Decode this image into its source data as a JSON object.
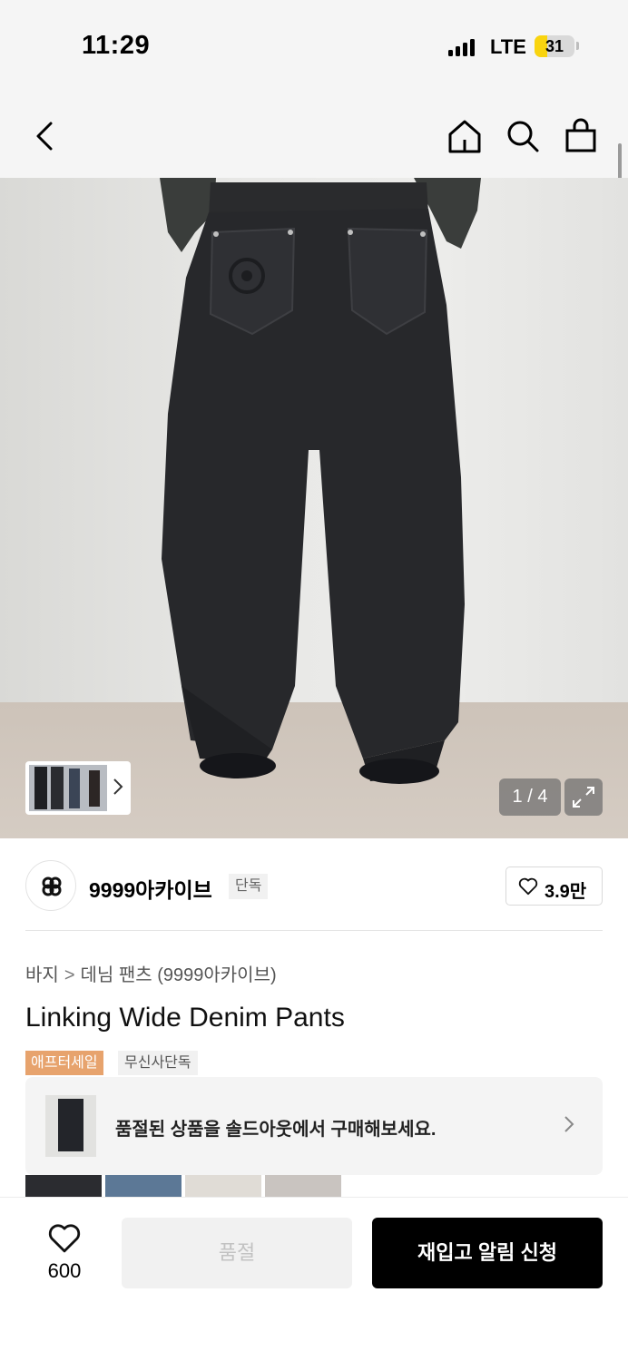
{
  "status_bar": {
    "time": "11:29",
    "network": "LTE",
    "battery": "31",
    "battery_level": 0.31
  },
  "nav": {
    "icons": [
      "back-icon",
      "home-icon",
      "search-icon",
      "cart-icon"
    ]
  },
  "gallery": {
    "pager": "1 / 4",
    "icons": [
      "chevron-right-icon",
      "expand-icon"
    ]
  },
  "brand": {
    "name": "9999아카이브",
    "badge": "단독",
    "like_count": "3.9만"
  },
  "breadcrumb": {
    "items": [
      "바지",
      "데님 팬츠 (9999아카이브)"
    ]
  },
  "product": {
    "title": "Linking Wide Denim Pants",
    "tags": [
      "애프터세일",
      "무신사단독"
    ]
  },
  "soldout_banner": {
    "text": "품절된 상품을 솔드아웃에서 구매해보세요."
  },
  "bottom_bar": {
    "wish_count": "600",
    "soldout_label": "품절",
    "restock_label": "재입고 알림 신청"
  },
  "colors": {
    "accent_tag": "#e7a36d",
    "primary_button": "#000000",
    "disabled_button": "#f1f1f1"
  }
}
